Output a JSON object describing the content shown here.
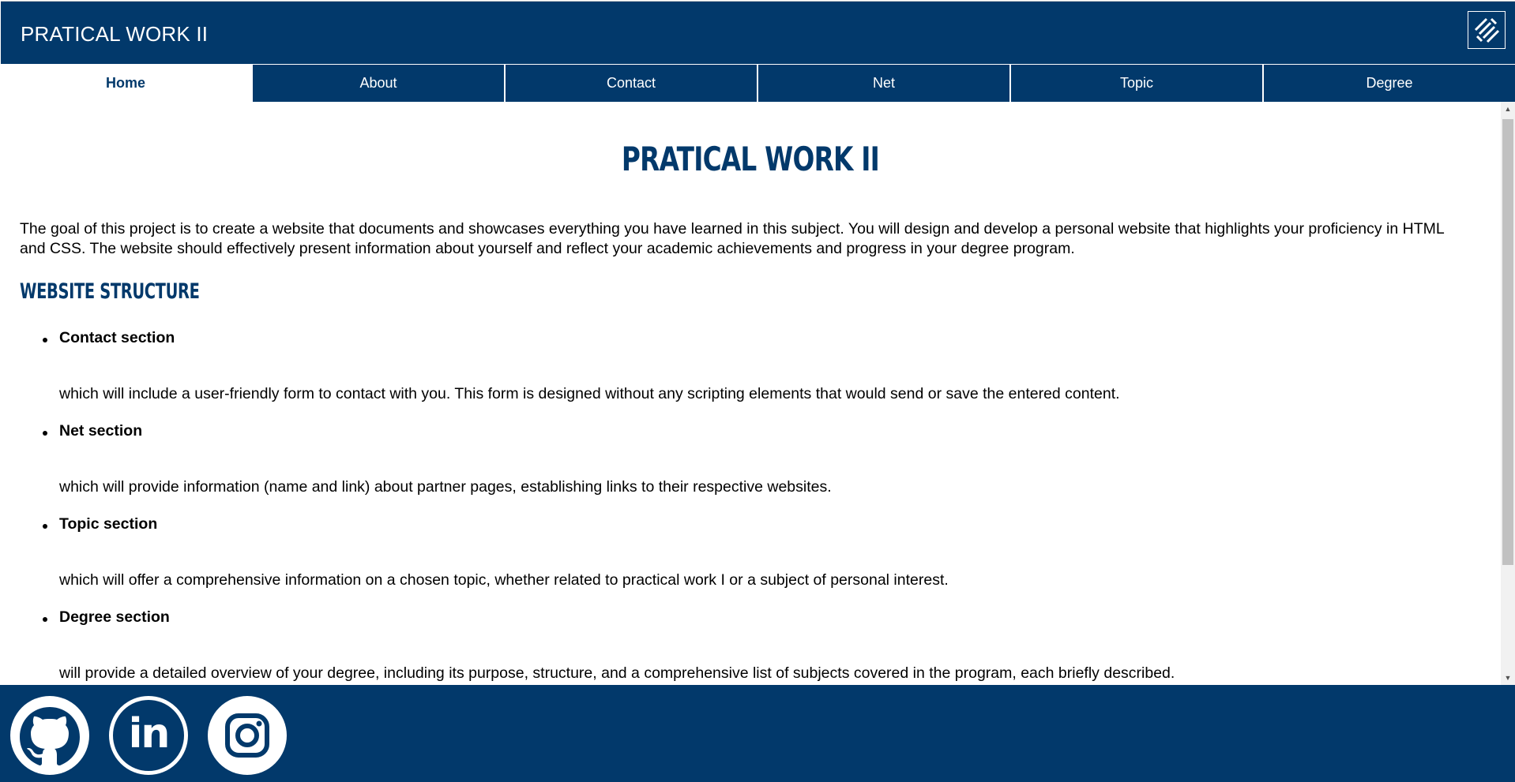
{
  "header": {
    "title": "PRATICAL WORK II",
    "logo_icon": "logo-icon"
  },
  "nav": {
    "items": [
      {
        "label": "Home",
        "active": true
      },
      {
        "label": "About",
        "active": false
      },
      {
        "label": "Contact",
        "active": false
      },
      {
        "label": "Net",
        "active": false
      },
      {
        "label": "Topic",
        "active": false
      },
      {
        "label": "Degree",
        "active": false
      }
    ]
  },
  "main": {
    "title": "PRATICAL WORK II",
    "intro": "The goal of this project is to create a website that documents and showcases everything you have learned in this subject. You will design and develop a personal website that highlights your proficiency in HTML and CSS. The website should effectively present information about yourself and reflect your academic achievements and progress in your degree program.",
    "structure_heading": "WEBSITE STRUCTURE",
    "sections": [
      {
        "title": "Contact section",
        "description": "which will include a user-friendly form to contact with you. This form is designed without any scripting elements that would send or save the entered content."
      },
      {
        "title": "Net section",
        "description": "which will provide information (name and link) about partner pages, establishing links to their respective websites."
      },
      {
        "title": "Topic section",
        "description": "which will offer a comprehensive information on a chosen topic, whether related to practical work I or a subject of personal interest."
      },
      {
        "title": "Degree section",
        "description": "will provide a detailed overview of your degree, including its purpose, structure, and a comprehensive list of subjects covered in the program, each briefly described."
      }
    ]
  },
  "footer": {
    "social_icons": [
      "github-icon",
      "linkedin-icon",
      "instagram-icon"
    ]
  },
  "colors": {
    "primary": "#02396b",
    "background": "#ffffff",
    "text": "#000000"
  }
}
